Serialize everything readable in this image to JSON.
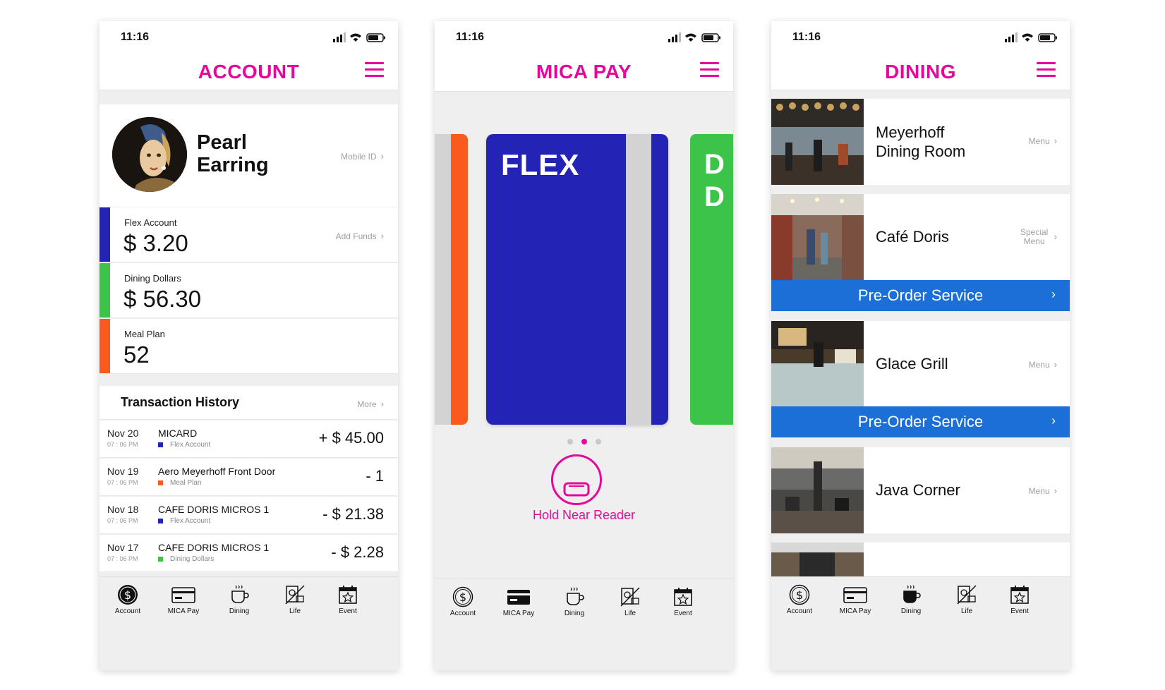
{
  "status": {
    "time": "11:16"
  },
  "account": {
    "title": "ACCOUNT",
    "user_name": "Pearl Earring",
    "mobile_id": "Mobile ID",
    "accounts": [
      {
        "label": "Flex Account",
        "value": "$ 3.20",
        "action": "Add Funds",
        "color": "#2323b5"
      },
      {
        "label": "Dining Dollars",
        "value": "$ 56.30",
        "action": "",
        "color": "#3cc44a"
      },
      {
        "label": "Meal Plan",
        "value": "52",
        "action": "",
        "color": "#fa5a1e"
      }
    ],
    "transactions_title": "Transaction History",
    "transactions_more": "More",
    "transactions": [
      {
        "date": "Nov 20",
        "time": "07 : 06 PM",
        "name": "MICARD",
        "account": "Flex Account",
        "amount": "+ $ 45.00",
        "color": "#2323b5"
      },
      {
        "date": "Nov 19",
        "time": "07 : 06 PM",
        "name": "Aero Meyerhoff Front Door",
        "account": "Meal Plan",
        "amount": "- 1",
        "color": "#fa5a1e"
      },
      {
        "date": "Nov 18",
        "time": "07 : 06 PM",
        "name": "CAFE DORIS MICROS 1",
        "account": "Flex Account",
        "amount": "- $ 21.38",
        "color": "#2323b5"
      },
      {
        "date": "Nov 17",
        "time": "07 : 06 PM",
        "name": "CAFE DORIS MICROS 1",
        "account": "Dining Dollars",
        "amount": "- $ 2.28",
        "color": "#3cc44a"
      }
    ]
  },
  "micapay": {
    "title": "MICA PAY",
    "card_name": "FLEX",
    "next_card_letters": "D\nD",
    "hold_label": "Hold Near Reader"
  },
  "dining": {
    "title": "DINING",
    "venues": [
      {
        "name": "Meyerhoff Dining Room",
        "link": "Menu"
      },
      {
        "name": "Café Doris",
        "link": "Special Menu"
      },
      {
        "name": "Glace Grill",
        "link": "Menu"
      },
      {
        "name": "Java Corner",
        "link": "Menu"
      }
    ],
    "preorder_label": "Pre-Order Service"
  },
  "tabs": [
    {
      "label": "Account",
      "icon": "dollar-coin-icon"
    },
    {
      "label": "MICA Pay",
      "icon": "card-icon"
    },
    {
      "label": "Dining",
      "icon": "coffee-cup-icon"
    },
    {
      "label": "Life",
      "icon": "life-icon"
    },
    {
      "label": "Event",
      "icon": "calendar-star-icon"
    }
  ],
  "colors": {
    "accent": "#e5089b",
    "flex": "#2323b5",
    "dining": "#3cc44a",
    "meal": "#fa5a1e",
    "preorder": "#1b6fd6"
  }
}
